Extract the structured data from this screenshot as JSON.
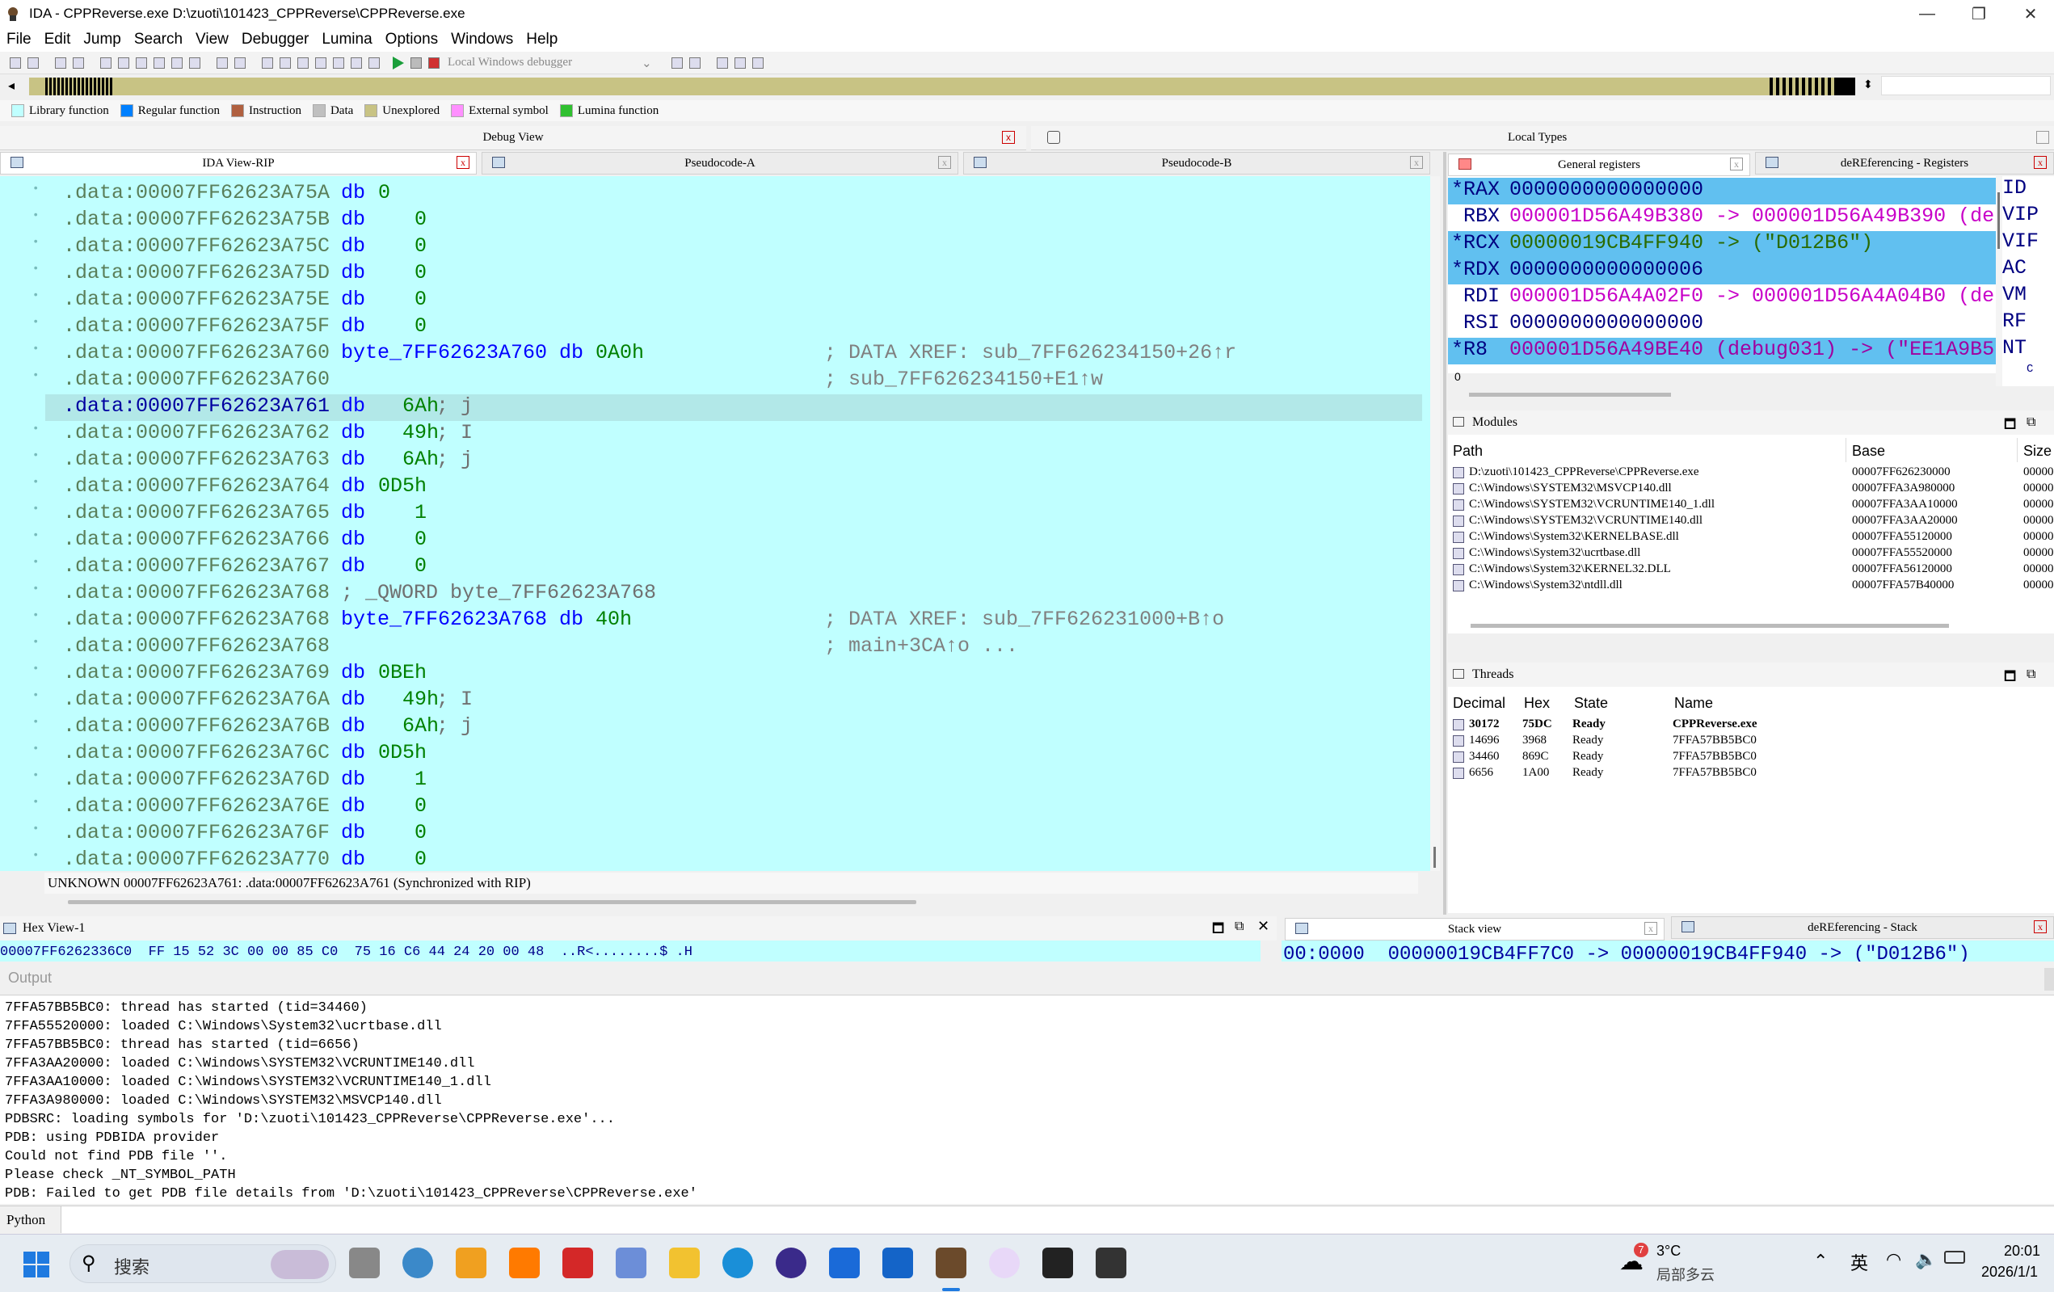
{
  "window": {
    "title": "IDA - CPPReverse.exe D:\\zuoti\\101423_CPPReverse\\CPPReverse.exe"
  },
  "menu": [
    "File",
    "Edit",
    "Jump",
    "Search",
    "View",
    "Debugger",
    "Lumina",
    "Options",
    "Windows",
    "Help"
  ],
  "toolbar": {
    "debugger_select": "Local Windows debugger"
  },
  "legend": [
    {
      "label": "Library function",
      "color": "#c0ffff"
    },
    {
      "label": "Regular function",
      "color": "#0080ff"
    },
    {
      "label": "Instruction",
      "color": "#b06040"
    },
    {
      "label": "Data",
      "color": "#c0c0c0"
    },
    {
      "label": "Unexplored",
      "color": "#c8c384"
    },
    {
      "label": "External symbol",
      "color": "#ff90ff"
    },
    {
      "label": "Lumina function",
      "color": "#30c030"
    }
  ],
  "panels": {
    "debug_view": "Debug View",
    "local_types": "Local Types"
  },
  "tabs": {
    "ida_view": "IDA View-RIP",
    "pseudo_a": "Pseudocode-A",
    "pseudo_b": "Pseudocode-B",
    "gen_regs": "General registers",
    "deref_regs": "deREferencing - Registers",
    "hex": "Hex View-1",
    "stack": "Stack view",
    "deref_stack": "deREferencing - Stack"
  },
  "disasm": [
    {
      "addr": ".data:00007FF62623A75A",
      "kw": "db",
      "val": "0",
      "cmt": ""
    },
    {
      "addr": ".data:00007FF62623A75B",
      "kw": "db",
      "val": "   0",
      "cmt": ""
    },
    {
      "addr": ".data:00007FF62623A75C",
      "kw": "db",
      "val": "   0",
      "cmt": ""
    },
    {
      "addr": ".data:00007FF62623A75D",
      "kw": "db",
      "val": "   0",
      "cmt": ""
    },
    {
      "addr": ".data:00007FF62623A75E",
      "kw": "db",
      "val": "   0",
      "cmt": ""
    },
    {
      "addr": ".data:00007FF62623A75F",
      "kw": "db",
      "val": "   0",
      "cmt": ""
    },
    {
      "addr": ".data:00007FF62623A760",
      "kw": "byte_7FF62623A760 db",
      "val": "0A0h",
      "cmt": "",
      "xref": "; DATA XREF: sub_7FF626234150+26↑r"
    },
    {
      "addr": ".data:00007FF62623A760",
      "kw": "",
      "val": "",
      "cmt": "",
      "xref": "; sub_7FF626234150+E1↑w"
    },
    {
      "addr": ".data:00007FF62623A761",
      "kw": "db",
      "val": "  6Ah",
      "cmt": "; j",
      "sel": true
    },
    {
      "addr": ".data:00007FF62623A762",
      "kw": "db",
      "val": "  49h",
      "cmt": "; I"
    },
    {
      "addr": ".data:00007FF62623A763",
      "kw": "db",
      "val": "  6Ah",
      "cmt": "; j"
    },
    {
      "addr": ".data:00007FF62623A764",
      "kw": "db",
      "val": "0D5h",
      "cmt": ""
    },
    {
      "addr": ".data:00007FF62623A765",
      "kw": "db",
      "val": "   1",
      "cmt": ""
    },
    {
      "addr": ".data:00007FF62623A766",
      "kw": "db",
      "val": "   0",
      "cmt": ""
    },
    {
      "addr": ".data:00007FF62623A767",
      "kw": "db",
      "val": "   0",
      "cmt": ""
    },
    {
      "addr": ".data:00007FF62623A768",
      "kw": "",
      "val": "",
      "cmt": "; _QWORD byte_7FF62623A768"
    },
    {
      "addr": ".data:00007FF62623A768",
      "kw": "byte_7FF62623A768 db",
      "val": "40h",
      "cmt": "",
      "xref": "; DATA XREF: sub_7FF626231000+B↑o"
    },
    {
      "addr": ".data:00007FF62623A768",
      "kw": "",
      "val": "",
      "cmt": "",
      "xref": "; main+3CA↑o ..."
    },
    {
      "addr": ".data:00007FF62623A769",
      "kw": "db",
      "val": "0BEh",
      "cmt": ""
    },
    {
      "addr": ".data:00007FF62623A76A",
      "kw": "db",
      "val": "  49h",
      "cmt": "; I"
    },
    {
      "addr": ".data:00007FF62623A76B",
      "kw": "db",
      "val": "  6Ah",
      "cmt": "; j"
    },
    {
      "addr": ".data:00007FF62623A76C",
      "kw": "db",
      "val": "0D5h",
      "cmt": ""
    },
    {
      "addr": ".data:00007FF62623A76D",
      "kw": "db",
      "val": "   1",
      "cmt": ""
    },
    {
      "addr": ".data:00007FF62623A76E",
      "kw": "db",
      "val": "   0",
      "cmt": ""
    },
    {
      "addr": ".data:00007FF62623A76F",
      "kw": "db",
      "val": "   0",
      "cmt": ""
    },
    {
      "addr": ".data:00007FF62623A770",
      "kw": "db",
      "val": "   0",
      "cmt": ""
    }
  ],
  "ida_status": "UNKNOWN 00007FF62623A761: .data:00007FF62623A761 (Synchronized with RIP)",
  "registers": [
    {
      "name": "*RAX",
      "value": "0000000000000000",
      "hl": true
    },
    {
      "name": " RBX",
      "value": "000001D56A49B380 -> 000001D56A49B390 (de",
      "hl": false
    },
    {
      "name": "*RCX",
      "value": "00000019CB4FF940 -> (\"D012B6\")",
      "hl": true
    },
    {
      "name": "*RDX",
      "value": "0000000000000006",
      "hl": true
    },
    {
      "name": " RDI",
      "value": "000001D56A4A02F0 -> 000001D56A4A04B0 (de",
      "hl": false
    },
    {
      "name": " RSI",
      "value": "0000000000000000",
      "hl": false
    },
    {
      "name": "*R8",
      "value": "000001D56A49BE40 (debug031) -> (\"EE1A9B5",
      "hl": true
    }
  ],
  "reg_index": "0",
  "flags": [
    "ID",
    "VIP",
    "VIF",
    "AC",
    "VM",
    "RF",
    "NT"
  ],
  "flag_index": "C",
  "modules": {
    "title": "Modules",
    "headers": [
      "Path",
      "Base",
      "Size"
    ],
    "rows": [
      {
        "path": "D:\\zuoti\\101423_CPPReverse\\CPPReverse.exe",
        "base": "00007FF626230000",
        "size": "00000"
      },
      {
        "path": "C:\\Windows\\SYSTEM32\\MSVCP140.dll",
        "base": "00007FFA3A980000",
        "size": "00000"
      },
      {
        "path": "C:\\Windows\\SYSTEM32\\VCRUNTIME140_1.dll",
        "base": "00007FFA3AA10000",
        "size": "00000"
      },
      {
        "path": "C:\\Windows\\SYSTEM32\\VCRUNTIME140.dll",
        "base": "00007FFA3AA20000",
        "size": "00000"
      },
      {
        "path": "C:\\Windows\\System32\\KERNELBASE.dll",
        "base": "00007FFA55120000",
        "size": "00000"
      },
      {
        "path": "C:\\Windows\\System32\\ucrtbase.dll",
        "base": "00007FFA55520000",
        "size": "00000"
      },
      {
        "path": "C:\\Windows\\System32\\KERNEL32.DLL",
        "base": "00007FFA56120000",
        "size": "00000"
      },
      {
        "path": "C:\\Windows\\System32\\ntdll.dll",
        "base": "00007FFA57B40000",
        "size": "00000"
      }
    ]
  },
  "threads": {
    "title": "Threads",
    "headers": [
      "Decimal",
      "Hex",
      "State",
      "Name"
    ],
    "rows": [
      {
        "dec": "30172",
        "hex": "75DC",
        "state": "Ready",
        "name": "CPPReverse.exe",
        "bold": true
      },
      {
        "dec": "14696",
        "hex": "3968",
        "state": "Ready",
        "name": "7FFA57BB5BC0"
      },
      {
        "dec": "34460",
        "hex": "869C",
        "state": "Ready",
        "name": "7FFA57BB5BC0"
      },
      {
        "dec": "6656",
        "hex": "1A00",
        "state": "Ready",
        "name": "7FFA57BB5BC0"
      }
    ]
  },
  "hex": {
    "line": "00007FF6262336C0  FF 15 52 3C 00 00 85 C0  75 16 C6 44 24 20 00 48  ..R<........$ .H"
  },
  "stack": {
    "line": "00:0000  00000019CB4FF7C0 -> 00000019CB4FF940 -> (\"D012B6\")"
  },
  "output": {
    "title": "Output",
    "lines": [
      "7FFA57BB5BC0: thread has started (tid=34460)",
      "7FFA55520000: loaded C:\\Windows\\System32\\ucrtbase.dll",
      "7FFA57BB5BC0: thread has started (tid=6656)",
      "7FFA3AA20000: loaded C:\\Windows\\SYSTEM32\\VCRUNTIME140.dll",
      "7FFA3AA10000: loaded C:\\Windows\\SYSTEM32\\VCRUNTIME140_1.dll",
      "7FFA3A980000: loaded C:\\Windows\\SYSTEM32\\MSVCP140.dll",
      "PDBSRC: loading symbols for 'D:\\zuoti\\101423_CPPReverse\\CPPReverse.exe'...",
      "PDB: using PDBIDA provider",
      "Could not find PDB file ''.",
      "Please check _NT_SYMBOL_PATH",
      "PDB: Failed to get PDB file details from 'D:\\zuoti\\101423_CPPReverse\\CPPReverse.exe'"
    ],
    "python_label": "Python"
  },
  "taskbar": {
    "search": "搜索",
    "weather_temp": "3°C",
    "weather_desc": "局部多云",
    "weather_badge": "7",
    "ime": "英",
    "time": "20:01",
    "date": "2026/1/1"
  }
}
